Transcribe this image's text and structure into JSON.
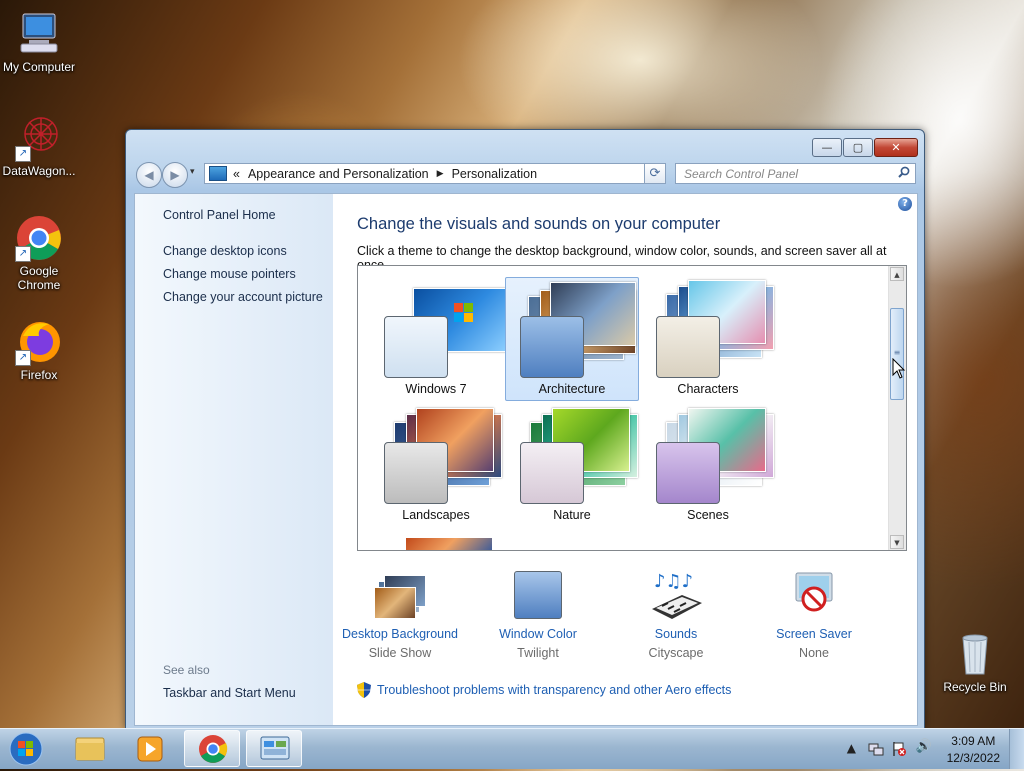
{
  "desktop": {
    "icons": [
      {
        "label": "My Computer"
      },
      {
        "label": "DataWagon..."
      },
      {
        "label": "Google Chrome"
      },
      {
        "label": "Firefox"
      },
      {
        "label": "Recycle Bin"
      }
    ]
  },
  "window": {
    "caption_buttons": {
      "minimize": "—",
      "maximize": "▢",
      "close": "✕"
    },
    "nav": {
      "back": "◀",
      "forward": "▶",
      "recent": "▾"
    },
    "breadcrumb": {
      "overflow": "«",
      "items": [
        "Appearance and Personalization",
        "Personalization"
      ],
      "separator": "▶",
      "dropdown": "▾"
    },
    "refresh": "⟳",
    "search": {
      "placeholder": "Search Control Panel"
    }
  },
  "left_pane": {
    "home": "Control Panel Home",
    "links": [
      "Change desktop icons",
      "Change mouse pointers",
      "Change your account picture"
    ],
    "see_also_header": "See also",
    "see_also_links": [
      "Taskbar and Start Menu"
    ]
  },
  "main": {
    "help": "?",
    "heading": "Change the visuals and sounds on your computer",
    "subheading": "Click a theme to change the desktop background, window color, sounds, and screen saver all at once.",
    "themes": [
      {
        "name": "Windows 7",
        "selected": false
      },
      {
        "name": "Architecture",
        "selected": true
      },
      {
        "name": "Characters",
        "selected": false
      },
      {
        "name": "Landscapes",
        "selected": false
      },
      {
        "name": "Nature",
        "selected": false
      },
      {
        "name": "Scenes",
        "selected": false
      }
    ],
    "scroll": {
      "up": "▲",
      "down": "▼",
      "grip": "≡"
    },
    "settings": [
      {
        "link": "Desktop Background",
        "value": "Slide Show"
      },
      {
        "link": "Window Color",
        "value": "Twilight"
      },
      {
        "link": "Sounds",
        "value": "Cityscape"
      },
      {
        "link": "Screen Saver",
        "value": "None"
      }
    ],
    "troubleshoot": "Troubleshoot problems with transparency and other Aero effects"
  },
  "taskbar": {
    "time": "3:09 AM",
    "date": "12/3/2022",
    "tray_show_hidden": "▲",
    "volume": "🔊"
  },
  "colors": {
    "link": "#1e5fb3",
    "heading": "#1c3b6e",
    "selection": "#cfe4fb"
  }
}
